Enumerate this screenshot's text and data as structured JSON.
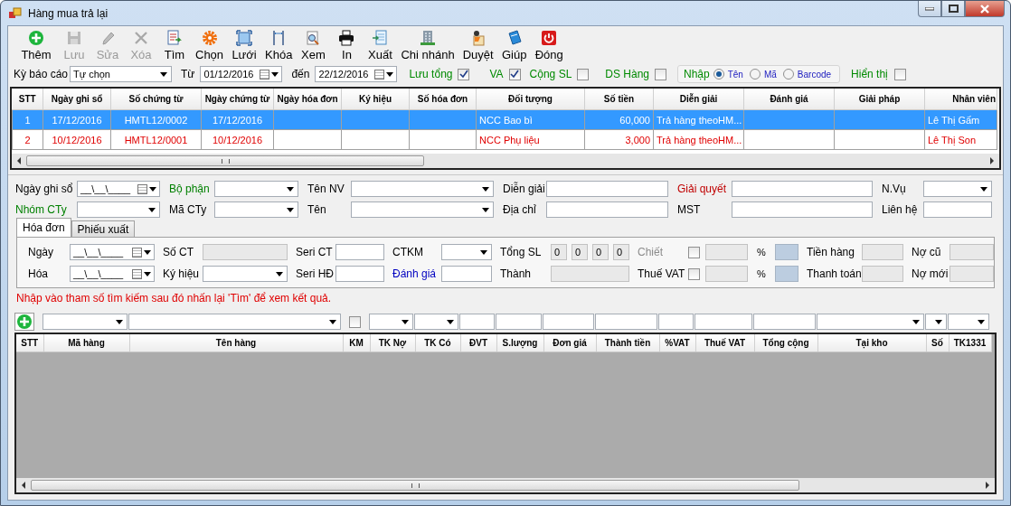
{
  "window": {
    "title": "Hàng mua trả lại"
  },
  "toolbar": [
    {
      "label": "Thêm",
      "kind": "add",
      "disabled": false
    },
    {
      "label": "Lưu",
      "kind": "save",
      "disabled": true
    },
    {
      "label": "Sửa",
      "kind": "edit",
      "disabled": true
    },
    {
      "label": "Xóa",
      "kind": "delete",
      "disabled": true
    },
    {
      "label": "Tìm",
      "kind": "find",
      "disabled": false
    },
    {
      "label": "Chọn",
      "kind": "choose",
      "disabled": false
    },
    {
      "label": "Lưới",
      "kind": "grid",
      "disabled": false
    },
    {
      "label": "Khóa",
      "kind": "lock",
      "disabled": false
    },
    {
      "label": "Xem",
      "kind": "preview",
      "disabled": false
    },
    {
      "label": "In",
      "kind": "print",
      "disabled": false
    },
    {
      "label": "Xuất",
      "kind": "export",
      "disabled": false
    },
    {
      "label": "Chi nhánh",
      "kind": "branch",
      "disabled": false
    },
    {
      "label": "Duyệt",
      "kind": "approve",
      "disabled": false
    },
    {
      "label": "Giúp",
      "kind": "help",
      "disabled": false
    },
    {
      "label": "Đóng",
      "kind": "close",
      "disabled": false
    }
  ],
  "filter": {
    "period": {
      "label": "Kỳ báo cáo",
      "value": "Tự chọn"
    },
    "from": {
      "label": "Từ",
      "value": "01/12/2016"
    },
    "to": {
      "label": "đến",
      "value": "22/12/2016"
    },
    "options": [
      {
        "label": "Lưu tổng",
        "checked": true
      },
      {
        "label": "VA",
        "checked": true
      },
      {
        "label": "Cộng SL",
        "checked": false
      },
      {
        "label": "DS Hàng",
        "checked": false
      }
    ],
    "input_mode": {
      "label": "Nhập",
      "choices": [
        {
          "label": "Tên",
          "selected": true
        },
        {
          "label": "Mã",
          "selected": false
        },
        {
          "label": "Barcode",
          "selected": false
        }
      ]
    },
    "show": {
      "label": "Hiển thị",
      "checked": false
    }
  },
  "vouchers": {
    "columns": [
      "STT",
      "Ngày ghi sổ",
      "Số chứng từ",
      "Ngày chứng từ",
      "Ngày hóa đơn",
      "Ký hiệu",
      "Số hóa đơn",
      "Đối tượng",
      "Số tiền",
      "Diễn giải",
      "Đánh giá",
      "Giải pháp",
      "Nhân viên"
    ],
    "rows": [
      {
        "selected": true,
        "cells": [
          "1",
          "17/12/2016",
          "HMTL12/0002",
          "17/12/2016",
          null,
          null,
          null,
          "NCC Bao bì",
          "60,000",
          "Trả hàng theoHM...",
          null,
          null,
          "Lê Thị Gấm"
        ]
      },
      {
        "selected": false,
        "cells": [
          "2",
          "10/12/2016",
          "HMTL12/0001",
          "10/12/2016",
          null,
          null,
          null,
          "NCC Phụ liệu",
          "3,000",
          "Trả hàng theoHM...",
          null,
          null,
          "Lê Thị Son"
        ]
      }
    ]
  },
  "header_form": {
    "rows": [
      [
        {
          "label": "Ngày ghi sổ",
          "controls": [
            {
              "kind": "date",
              "value": "__\\__\\____"
            }
          ]
        },
        {
          "label": "Bộ phận",
          "color": "#008000",
          "controls": [
            {
              "kind": "combo"
            }
          ]
        },
        {
          "label": "Tên NV",
          "controls": [
            {
              "kind": "combo"
            }
          ]
        },
        {
          "label": "Diễn giải",
          "controls": [
            {
              "kind": "text"
            }
          ]
        },
        {
          "label": "Giải quyết",
          "color": "#c00000",
          "controls": [
            {
              "kind": "text"
            }
          ]
        },
        {
          "label": "N.Vụ",
          "controls": [
            {
              "kind": "combo"
            }
          ]
        }
      ],
      [
        {
          "label": "Nhóm CTy",
          "color": "#008000",
          "controls": [
            {
              "kind": "combo"
            }
          ]
        },
        {
          "label": "Mã CTy",
          "controls": [
            {
              "kind": "combo"
            }
          ]
        },
        {
          "label": "Tên",
          "controls": [
            {
              "kind": "combo"
            }
          ]
        },
        {
          "label": "Địa chỉ",
          "controls": [
            {
              "kind": "text"
            }
          ]
        },
        {
          "label": "MST",
          "controls": [
            {
              "kind": "text"
            }
          ]
        },
        {
          "label": "Liên hệ",
          "controls": [
            {
              "kind": "text"
            }
          ]
        }
      ]
    ]
  },
  "tabs": [
    {
      "label": "Hóa đơn",
      "selected": true
    },
    {
      "label": "Phiếu xuất",
      "selected": false
    }
  ],
  "invoice_form": {
    "rows": [
      [
        {
          "label": "Ngày",
          "controls": [
            {
              "kind": "date",
              "value": "__\\__\\____"
            }
          ]
        },
        {
          "label": "Số CT",
          "controls": [
            {
              "kind": "readonly"
            }
          ]
        },
        {
          "label": "Seri CT",
          "controls": [
            {
              "kind": "text"
            }
          ]
        },
        {
          "label": "CTKM",
          "controls": [
            {
              "kind": "combo"
            }
          ]
        },
        {
          "label": "Tổng SL",
          "controls": [
            {
              "kind": "readonly",
              "value": "0"
            },
            {
              "kind": "readonly",
              "value": "0"
            },
            {
              "kind": "readonly",
              "value": "0"
            },
            {
              "kind": "readonly",
              "value": "0"
            }
          ]
        },
        {
          "label": "Chiết",
          "color": "#8c8c8c",
          "controls": [
            {
              "kind": "check",
              "checked": false
            },
            {
              "kind": "readonly"
            },
            {
              "kind": "unit",
              "value": "%"
            },
            {
              "kind": "swatch"
            }
          ]
        },
        {
          "label": "Tiền hàng",
          "controls": [
            {
              "kind": "readonly"
            }
          ]
        },
        {
          "label": "Nợ cũ",
          "controls": [
            {
              "kind": "readonly"
            }
          ]
        }
      ],
      [
        {
          "label": "Hóa",
          "controls": [
            {
              "kind": "date",
              "value": "__\\__\\____"
            }
          ]
        },
        {
          "label": "Ký hiệu",
          "controls": [
            {
              "kind": "combo"
            }
          ]
        },
        {
          "label": "Seri HĐ",
          "controls": [
            {
              "kind": "text"
            }
          ]
        },
        {
          "label": "Đánh giá",
          "color": "#0000c0",
          "controls": [
            {
              "kind": "text"
            }
          ]
        },
        {
          "label": "Thành",
          "controls": [
            {
              "kind": "readonly"
            }
          ]
        },
        {
          "label": "Thuế VAT",
          "controls": [
            {
              "kind": "check",
              "checked": false
            },
            {
              "kind": "readonly"
            },
            {
              "kind": "unit",
              "value": "%"
            },
            {
              "kind": "swatch"
            }
          ]
        },
        {
          "label": "Thanh toán",
          "controls": [
            {
              "kind": "readonly"
            }
          ]
        },
        {
          "label": "Nợ mới",
          "controls": [
            {
              "kind": "readonly"
            }
          ]
        }
      ]
    ]
  },
  "hint": "Nhập vào tham số tìm kiếm sau đó nhấn lại 'Tìm' để xem kết quả.",
  "lines": {
    "columns": [
      {
        "label": "STT",
        "kind": "add"
      },
      {
        "label": "Mã hàng",
        "kind": "combo"
      },
      {
        "label": "Tên hàng",
        "kind": "combo"
      },
      {
        "label": "KM",
        "kind": "check",
        "checked": false
      },
      {
        "label": "TK Nợ",
        "kind": "combo"
      },
      {
        "label": "TK Có",
        "kind": "combo"
      },
      {
        "label": "ĐVT",
        "kind": "text"
      },
      {
        "label": "S.lượng",
        "kind": "text"
      },
      {
        "label": "Đơn giá",
        "kind": "text"
      },
      {
        "label": "Thành tiền",
        "kind": "text"
      },
      {
        "label": "%VAT",
        "kind": "text"
      },
      {
        "label": "Thuế VAT",
        "kind": "text"
      },
      {
        "label": "Tổng cộng",
        "kind": "text"
      },
      {
        "label": "Tại kho",
        "kind": "combo"
      },
      {
        "label": "Số",
        "kind": "combo"
      },
      {
        "label": "TK1331",
        "kind": "combo"
      }
    ]
  }
}
